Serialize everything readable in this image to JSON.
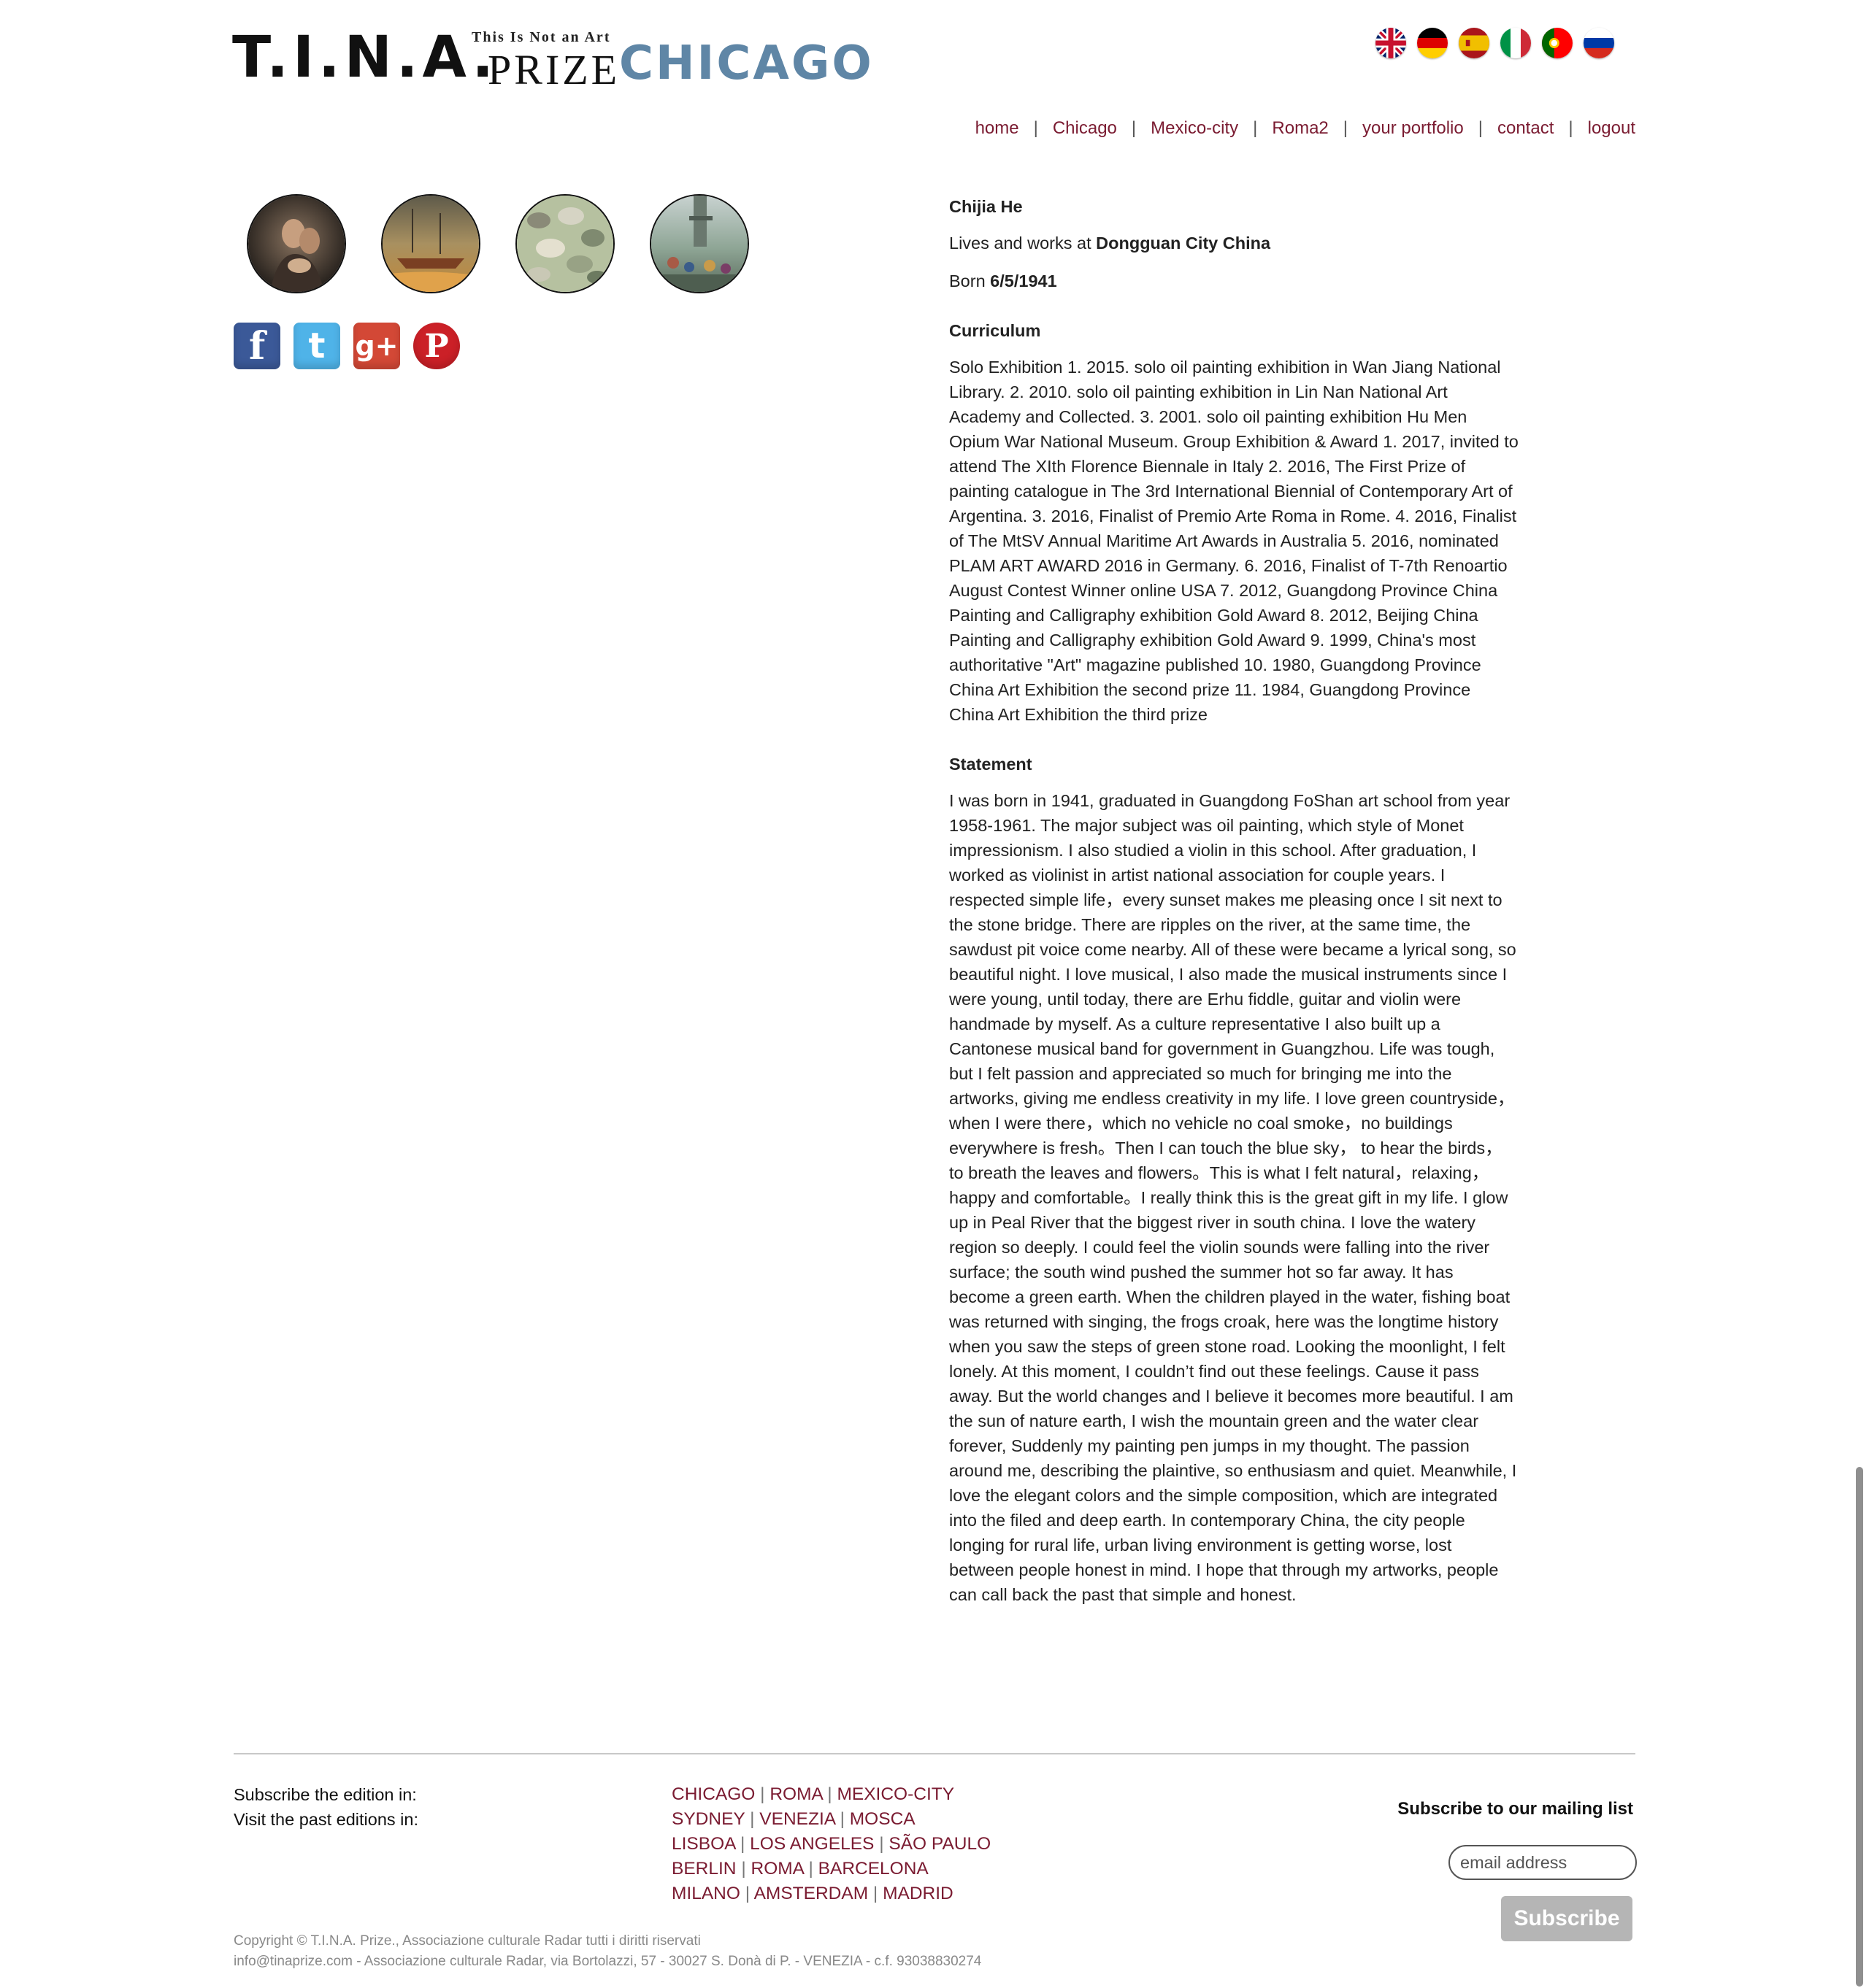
{
  "logo": {
    "tina": "T.I.N.A.",
    "tagline": "This Is Not an Art",
    "prize": "PRIZE",
    "edition": "CHICAGO"
  },
  "flags": [
    {
      "name": "english-flag-icon"
    },
    {
      "name": "german-flag-icon"
    },
    {
      "name": "spanish-flag-icon"
    },
    {
      "name": "italian-flag-icon"
    },
    {
      "name": "portuguese-flag-icon"
    },
    {
      "name": "russian-flag-icon"
    }
  ],
  "nav": {
    "items": [
      "home",
      "Chicago",
      "Mexico-city",
      "Roma2",
      "your portfolio",
      "contact",
      "logout"
    ],
    "separator": "|"
  },
  "artist": {
    "name": "Chijia He",
    "lives_prefix": "Lives and works at ",
    "location": "Dongguan City China",
    "born_prefix": "Born ",
    "born": "6/5/1941",
    "curriculum_title": "Curriculum",
    "curriculum": "Solo Exhibition 1. 2015. solo oil painting exhibition in Wan Jiang National Library. 2. 2010. solo oil painting exhibition in Lin Nan National Art Academy and Collected. 3. 2001. solo oil painting exhibition Hu Men Opium War National Museum. Group Exhibition & Award 1. 2017, invited to attend The XIth Florence Biennale in Italy 2. 2016, The First Prize of painting catalogue in The 3rd International Biennial of Contemporary Art of Argentina. 3. 2016, Finalist of Premio Arte Roma in Rome. 4. 2016, Finalist of The MtSV Annual Maritime Art Awards in Australia 5. 2016, nominated PLAM ART AWARD 2016 in Germany. 6. 2016, Finalist of T-7th Renoartio August Contest Winner online USA 7. 2012, Guangdong Province China Painting and Calligraphy exhibition Gold Award 8. 2012, Beijing China Painting and Calligraphy exhibition Gold Award 9. 1999, China's most authoritative \"Art\" magazine published 10. 1980, Guangdong Province China Art Exhibition the second prize 11. 1984, Guangdong Province China Art Exhibition the third prize",
    "statement_title": "Statement",
    "statement": "I was born in 1941, graduated in Guangdong FoShan art school from year 1958-1961. The major subject was oil painting, which style of Monet impressionism. I also studied a violin in this school. After graduation, I worked as violinist in artist national association for couple years. I respected simple life，every sunset makes me pleasing once I sit next to the stone bridge. There are ripples on the river, at the same time, the sawdust pit voice come nearby. All of these were became a lyrical song, so beautiful night. I love musical, I also made the musical instruments since I were young, until today, there are Erhu fiddle, guitar and violin were handmade by myself. As a culture representative I also built up a Cantonese musical band for government in Guangzhou. Life was tough, but I felt passion and appreciated so much for bringing me into the artworks, giving me endless creativity in my life. I love green countryside，when I were there，which no vehicle no coal smoke，no buildings everywhere is fresh。Then I can touch the blue sky， to hear the birds， to breath the leaves and flowers。This is what I felt natural，relaxing，happy and comfortable。I really think this is the great gift in my life. I glow up in Peal River that the biggest river in south china. I love the watery region so deeply. I could feel the violin sounds were falling into the river surface; the south wind pushed the summer hot so far away. It has become a green earth. When the children played in the water, fishing boat was returned with singing, the frogs croak, here was the longtime history when you saw the steps of green stone road. Looking the moonlight, I felt lonely. At this moment, I couldn’t find out these feelings. Cause it pass away. But the world changes and I believe it becomes more beautiful. I am the sun of nature earth, I wish the mountain green and the water clear forever, Suddenly my painting pen jumps in my thought. The passion around me, describing the plaintive, so enthusiasm and quiet. Meanwhile, I love the elegant colors and the simple composition, which are integrated into the filed and deep earth. In contemporary China, the city people longing for rural life, urban living environment is getting worse, lost between people honest in mind. I hope that through my artworks, people can call back the past that simple and honest."
  },
  "social": [
    {
      "name": "facebook-icon",
      "glyph": "f",
      "color": "#3b5998"
    },
    {
      "name": "twitter-icon",
      "glyph": "t",
      "color": "#4fb3e8"
    },
    {
      "name": "google-plus-icon",
      "glyph": "g+",
      "color": "#d34836"
    },
    {
      "name": "pinterest-icon",
      "glyph": "P",
      "color": "#cb2027"
    }
  ],
  "footer": {
    "subscribe_edition": "Subscribe the edition in:",
    "visit_past": "Visit the past editions in:",
    "edition_rows": [
      [
        "CHICAGO",
        "ROMA",
        "MEXICO-CITY"
      ],
      [
        "SYDNEY",
        "VENEZIA",
        "MOSCA"
      ],
      [
        "LISBOA",
        "LOS ANGELES",
        "SÃO PAULO"
      ],
      [
        "BERLIN",
        "ROMA",
        "BARCELONA"
      ],
      [
        "MILANO",
        "AMSTERDAM",
        "MADRID"
      ]
    ],
    "mailing_title": "Subscribe to our mailing list",
    "email_placeholder": "email address",
    "subscribe_label": "Subscribe",
    "copyright": "Copyright © T.I.N.A. Prize., Associazione culturale Radar tutti i diritti riservati",
    "address": "info@tinaprize.com - Associazione culturale Radar, via Bortolazzi, 57 - 30027 S. Donà di P. - VENEZIA - c.f. 93038830274"
  },
  "colors": {
    "link": "#7a1b31",
    "edition": "#5f86a6",
    "button": "#b5b5b5"
  }
}
